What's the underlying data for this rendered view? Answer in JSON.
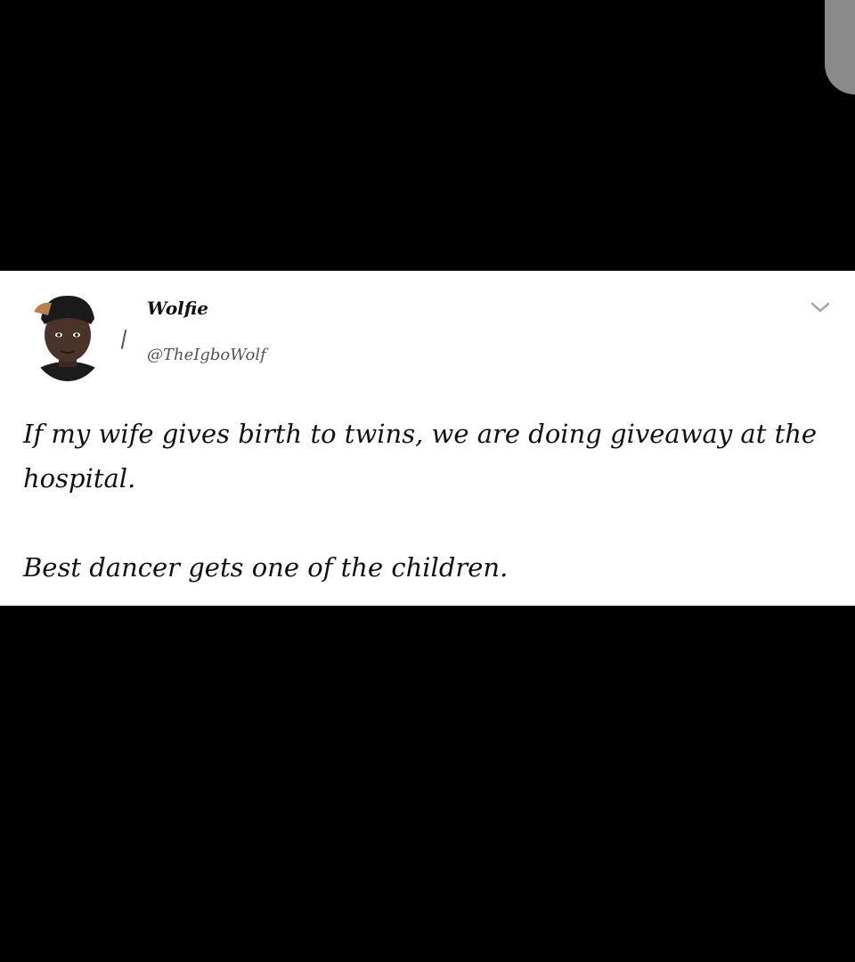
{
  "tweet": {
    "author": {
      "display_name": "Wolfie",
      "handle": "@TheIgboWolf",
      "avatar_icon": "user-avatar"
    },
    "menu_icon": "chevron-down-icon",
    "paragraphs": [
      "If my wife gives birth to twins, we are doing giveaway at the hospital.",
      "Best dancer gets one of the children."
    ]
  },
  "colors": {
    "background": "#000000",
    "card": "#ffffff",
    "text": "#111111",
    "muted": "#555555",
    "scroll_nub": "#8a8a8a"
  }
}
